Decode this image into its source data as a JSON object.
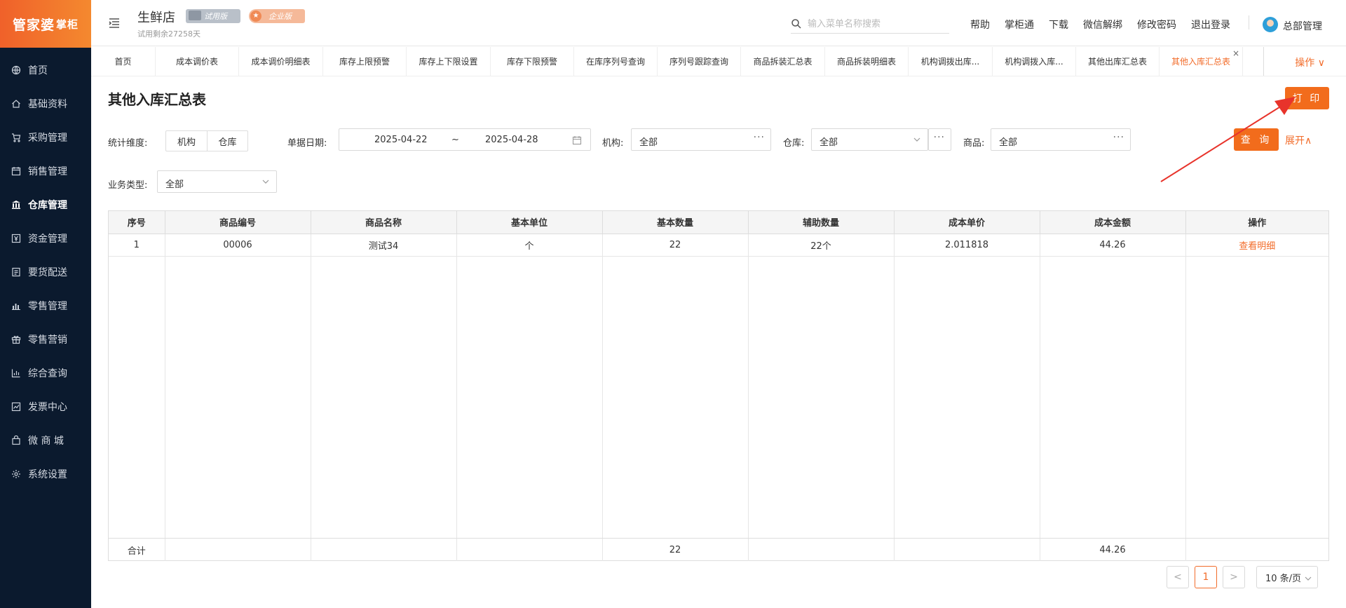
{
  "brand": {
    "logo_main": "管家婆",
    "logo_sub": "掌柜"
  },
  "sidebar": {
    "items": [
      {
        "label": "首页",
        "icon": "globe-icon"
      },
      {
        "label": "基础资料",
        "icon": "home-icon"
      },
      {
        "label": "采购管理",
        "icon": "cart-icon"
      },
      {
        "label": "销售管理",
        "icon": "calendar-icon"
      },
      {
        "label": "仓库管理",
        "icon": "bank-icon",
        "active": true
      },
      {
        "label": "资金管理",
        "icon": "yen-icon"
      },
      {
        "label": "要货配送",
        "icon": "list-icon"
      },
      {
        "label": "零售管理",
        "icon": "chart-icon"
      },
      {
        "label": "零售营销",
        "icon": "gift-icon"
      },
      {
        "label": "综合查询",
        "icon": "bar-chart-icon"
      },
      {
        "label": "发票中心",
        "icon": "trend-icon"
      },
      {
        "label": "微 商 城",
        "icon": "bag-icon"
      },
      {
        "label": "系统设置",
        "icon": "gear-icon"
      }
    ]
  },
  "header": {
    "store_name": "生鲜店",
    "badge_trial": "试用版",
    "badge_enterprise": "企业版",
    "trial_remaining": "试用剩余27258天",
    "search_placeholder": "输入菜单名称搜索",
    "links": [
      "帮助",
      "掌柜通",
      "下载",
      "微信解绑",
      "修改密码",
      "退出登录"
    ],
    "user": "总部管理"
  },
  "tabs": {
    "items": [
      "首页",
      "成本调价表",
      "成本调价明细表",
      "库存上限预警",
      "库存上下限设置",
      "库存下限预警",
      "在库序列号查询",
      "序列号跟踪查询",
      "商品拆装汇总表",
      "商品拆装明细表",
      "机构调拨出库...",
      "机构调拨入库...",
      "其他出库汇总表",
      "其他入库汇总表"
    ],
    "active_index": 13,
    "close_symbol": "×",
    "ops_label": "操作 ∨"
  },
  "page": {
    "title": "其他入库汇总表",
    "print_label": "打 印",
    "filters": {
      "dimension_label": "统计维度:",
      "dimension_options": [
        "机构",
        "仓库"
      ],
      "date_label": "单据日期:",
      "date_start": "2025-04-22",
      "date_sep": "~",
      "date_end": "2025-04-28",
      "org_label": "机构:",
      "org_value": "全部",
      "warehouse_label": "仓库:",
      "warehouse_value": "全部",
      "product_label": "商品:",
      "product_value": "全部",
      "biz_type_label": "业务类型:",
      "biz_type_value": "全部",
      "query_label": "查 询",
      "expand_label": "展开∧",
      "more_symbol": "···"
    },
    "table": {
      "columns": [
        "序号",
        "商品编号",
        "商品名称",
        "基本单位",
        "基本数量",
        "辅助数量",
        "成本单价",
        "成本金额",
        "操作"
      ],
      "rows": [
        [
          "1",
          "00006",
          "测试34",
          "个",
          "22",
          "22个",
          "2.011818",
          "44.26",
          "查看明细"
        ]
      ],
      "footer": [
        "合计",
        "",
        "",
        "",
        "22",
        "",
        "",
        "44.26",
        ""
      ]
    },
    "pagination": {
      "prev": "<",
      "current": "1",
      "next": ">",
      "page_size": "10 条/页"
    }
  },
  "colors": {
    "accent": "#f26c1c",
    "sidebar_bg": "#0b1a2e",
    "annotation": "#e8332b"
  }
}
